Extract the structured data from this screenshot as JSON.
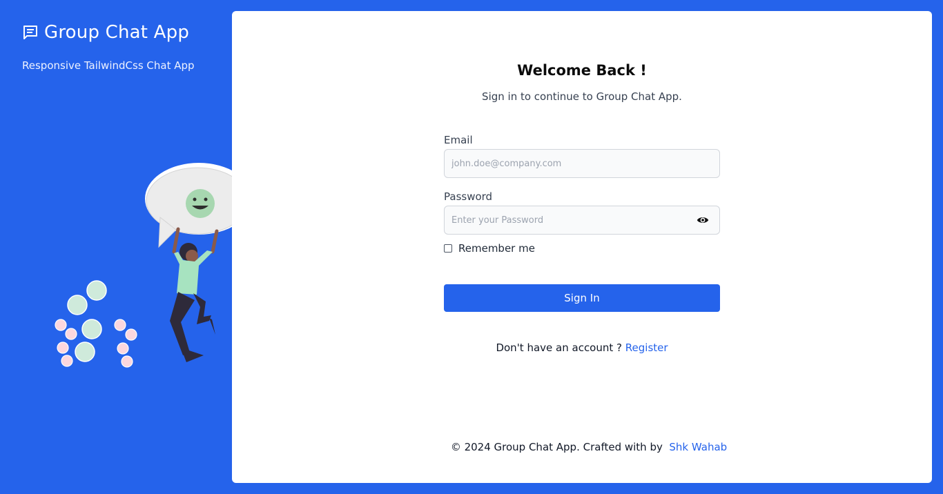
{
  "sidebar": {
    "icon": "chat-message-icon",
    "title": "Group Chat App",
    "tagline": "Responsive TailwindCss Chat App",
    "illustration": "person-with-speech-bubble-illustration"
  },
  "form": {
    "heading": "Welcome Back !",
    "subheading": "Sign in to continue to Group Chat App.",
    "email_label": "Email",
    "email_value": "",
    "email_placeholder": "john.doe@company.com",
    "password_label": "Password",
    "password_value": "",
    "password_placeholder": "Enter your Password",
    "show_password_icon": "eye-icon",
    "remember_label": "Remember me",
    "remember_checked": false,
    "signin_label": "Sign In",
    "no_account_text": "Don't have an account ?",
    "register_link": "Register"
  },
  "footer": {
    "text": "© 2024 Group Chat App. Crafted with by",
    "author_link": "Shk Wahab"
  },
  "colors": {
    "primary": "#2563eb",
    "card_bg": "#ffffff",
    "input_bg": "#f9fafb"
  }
}
